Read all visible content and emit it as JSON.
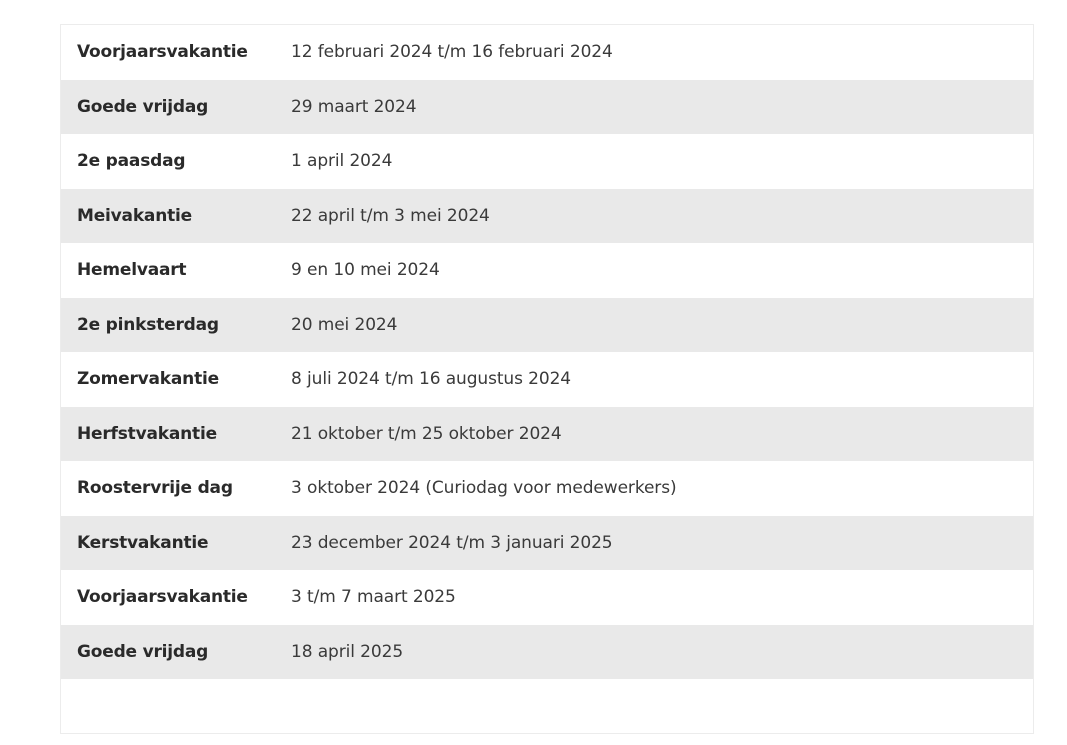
{
  "holidays": [
    {
      "name": "Voorjaarsvakantie",
      "date": "12 februari 2024 t/m 16 februari 2024"
    },
    {
      "name": "Goede vrijdag",
      "date": "29 maart 2024"
    },
    {
      "name": "2e paasdag",
      "date": "1 april 2024"
    },
    {
      "name": "Meivakantie",
      "date": "22 april t/m 3 mei 2024"
    },
    {
      "name": "Hemelvaart",
      "date": "9 en 10 mei 2024"
    },
    {
      "name": "2e pinksterdag",
      "date": "20 mei 2024"
    },
    {
      "name": "Zomervakantie",
      "date": "8 juli 2024 t/m 16 augustus 2024"
    },
    {
      "name": "Herfstvakantie",
      "date": "21 oktober t/m 25 oktober 2024"
    },
    {
      "name": "Roostervrije dag",
      "date": "3 oktober 2024 (Curiodag voor medewerkers)"
    },
    {
      "name": "Kerstvakantie",
      "date": "23 december 2024 t/m 3 januari 2025"
    },
    {
      "name": "Voorjaarsvakantie",
      "date": "3 t/m 7 maart 2025"
    },
    {
      "name": "Goede vrijdag",
      "date": "18 april 2025"
    }
  ],
  "colors": {
    "row_alt": "#e9e9e9",
    "row": "#ffffff",
    "text": "#2b2b2b"
  }
}
